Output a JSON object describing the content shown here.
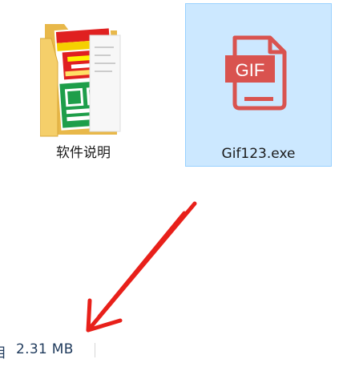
{
  "files": [
    {
      "name": "软件说明",
      "icon": "folder-icon"
    },
    {
      "name": "Gif123.exe",
      "icon": "gif-file-icon",
      "icon_text": "GIF",
      "selected": true
    }
  ],
  "status_bar": {
    "prefix": "目",
    "selected_size": "2.31 MB"
  },
  "colors": {
    "selection_bg": "#cce8ff",
    "selection_border": "#99d1ff",
    "gif_icon": "#d9534f",
    "annotation_arrow": "#e8201a"
  }
}
